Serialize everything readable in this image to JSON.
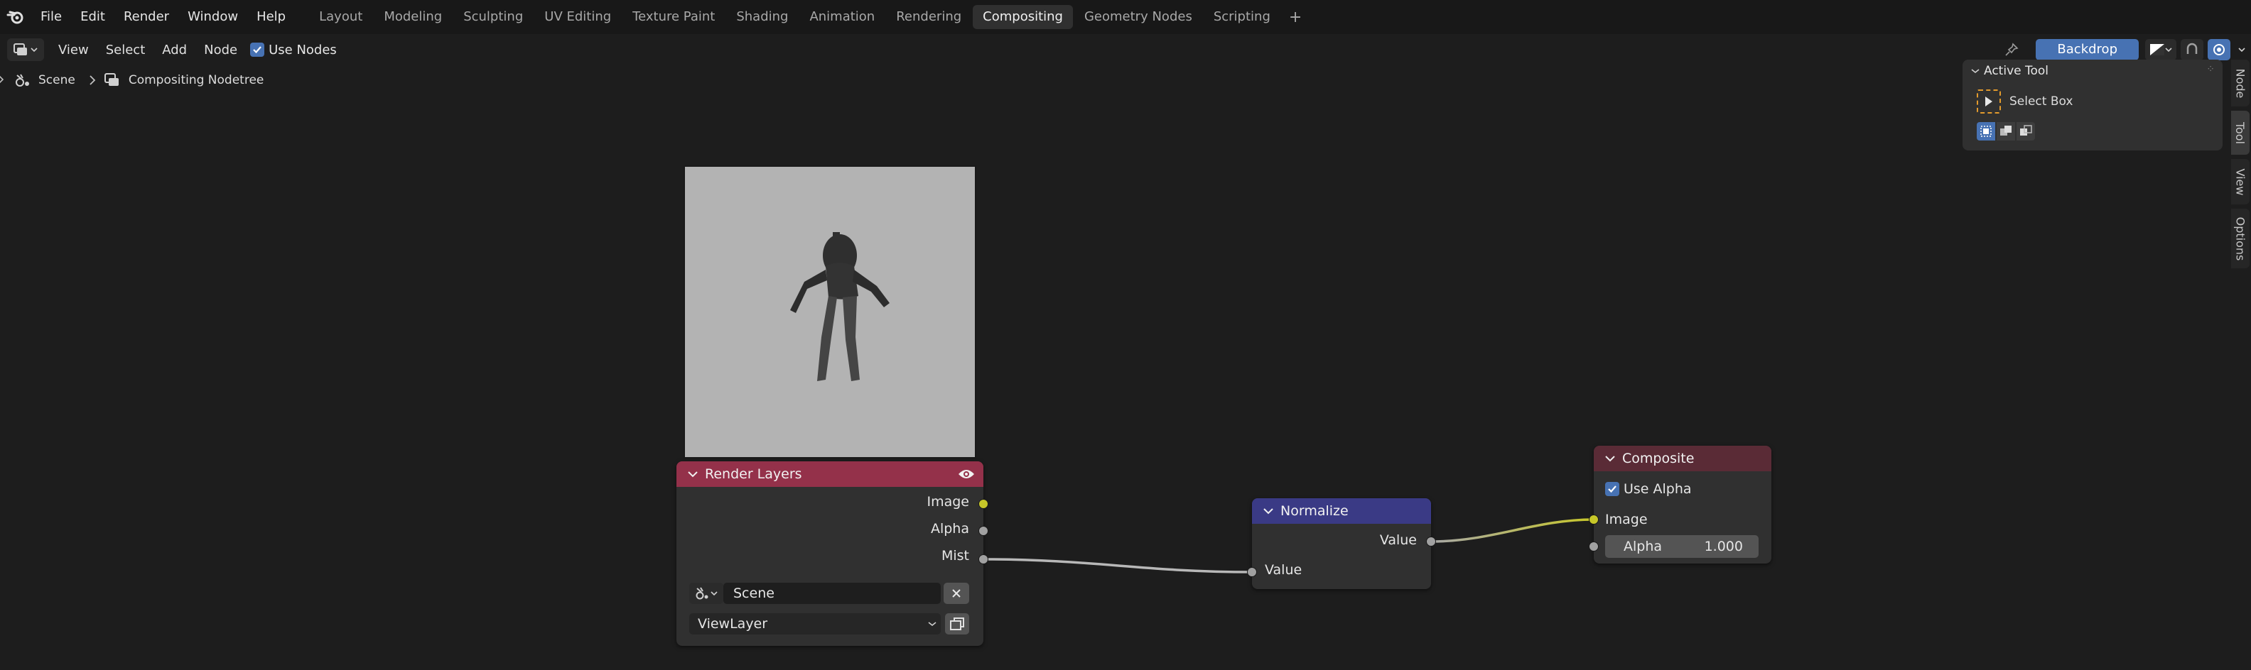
{
  "menu": [
    "File",
    "Edit",
    "Render",
    "Window",
    "Help"
  ],
  "workspaces": [
    "Layout",
    "Modeling",
    "Sculpting",
    "UV Editing",
    "Texture Paint",
    "Shading",
    "Animation",
    "Rendering",
    "Compositing",
    "Geometry Nodes",
    "Scripting"
  ],
  "active_workspace": "Compositing",
  "header": {
    "view": "View",
    "select": "Select",
    "add": "Add",
    "node": "Node",
    "use_nodes": "Use Nodes",
    "backdrop": "Backdrop"
  },
  "breadcrumb": {
    "scene": "Scene",
    "nodetree": "Compositing Nodetree"
  },
  "nodes": {
    "render_layers": {
      "title": "Render Layers",
      "header_color": "#94314a",
      "outputs": [
        "Image",
        "Alpha",
        "Mist"
      ],
      "scene": "Scene",
      "layer": "ViewLayer"
    },
    "normalize": {
      "title": "Normalize",
      "header_color": "#3a3a85",
      "output": "Value",
      "input": "Value"
    },
    "composite": {
      "title": "Composite",
      "header_color": "#5a2b36",
      "use_alpha": "Use Alpha",
      "image": "Image",
      "alpha_label": "Alpha",
      "alpha_value": "1.000"
    }
  },
  "npanel": {
    "section": "Active Tool",
    "tool": "Select Box",
    "tabs": [
      "Node",
      "Tool",
      "View",
      "Options"
    ],
    "active_tab": "Tool"
  },
  "colors": {
    "accent": "#4772b3",
    "socket_color": "#c7c729",
    "socket_value": "#a1a1a1"
  }
}
